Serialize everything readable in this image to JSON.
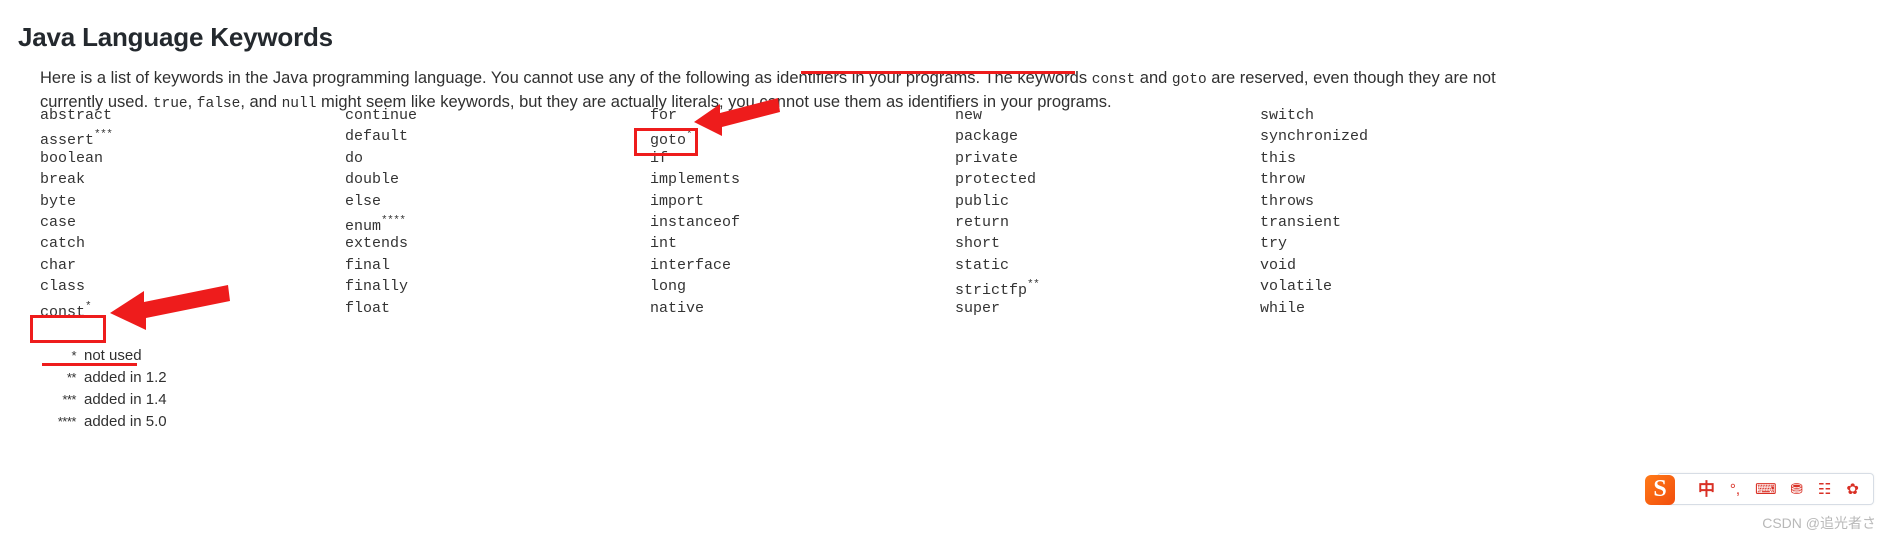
{
  "page": {
    "title": "Java Language Keywords",
    "intro": {
      "part1": "Here is a list of keywords in the Java programming language. You cannot use any of the following as identifiers in your programs. The keywords ",
      "code1": "const",
      "part2": " and ",
      "code2": "goto",
      "part3": " are reserved, even though they are not currently used. ",
      "code3": "true",
      "part4": ", ",
      "code4": "false",
      "part5": ", and ",
      "code5": "null",
      "part6": " might seem like keywords, but they are actually literals; you cannot use them as identifiers in your programs."
    }
  },
  "keywords": {
    "columns": [
      [
        {
          "word": "abstract",
          "mark": ""
        },
        {
          "word": "assert",
          "mark": "***"
        },
        {
          "word": "boolean",
          "mark": ""
        },
        {
          "word": "break",
          "mark": ""
        },
        {
          "word": "byte",
          "mark": ""
        },
        {
          "word": "case",
          "mark": ""
        },
        {
          "word": "catch",
          "mark": ""
        },
        {
          "word": "char",
          "mark": ""
        },
        {
          "word": "class",
          "mark": ""
        },
        {
          "word": "const",
          "mark": "*"
        }
      ],
      [
        {
          "word": "continue",
          "mark": ""
        },
        {
          "word": "default",
          "mark": ""
        },
        {
          "word": "do",
          "mark": ""
        },
        {
          "word": "double",
          "mark": ""
        },
        {
          "word": "else",
          "mark": ""
        },
        {
          "word": "enum",
          "mark": "****"
        },
        {
          "word": "extends",
          "mark": ""
        },
        {
          "word": "final",
          "mark": ""
        },
        {
          "word": "finally",
          "mark": ""
        },
        {
          "word": "float",
          "mark": ""
        }
      ],
      [
        {
          "word": "for",
          "mark": ""
        },
        {
          "word": "goto",
          "mark": "*"
        },
        {
          "word": "if",
          "mark": ""
        },
        {
          "word": "implements",
          "mark": ""
        },
        {
          "word": "import",
          "mark": ""
        },
        {
          "word": "instanceof",
          "mark": ""
        },
        {
          "word": "int",
          "mark": ""
        },
        {
          "word": "interface",
          "mark": ""
        },
        {
          "word": "long",
          "mark": ""
        },
        {
          "word": "native",
          "mark": ""
        }
      ],
      [
        {
          "word": "new",
          "mark": ""
        },
        {
          "word": "package",
          "mark": ""
        },
        {
          "word": "private",
          "mark": ""
        },
        {
          "word": "protected",
          "mark": ""
        },
        {
          "word": "public",
          "mark": ""
        },
        {
          "word": "return",
          "mark": ""
        },
        {
          "word": "short",
          "mark": ""
        },
        {
          "word": "static",
          "mark": ""
        },
        {
          "word": "strictfp",
          "mark": "**"
        },
        {
          "word": "super",
          "mark": ""
        }
      ],
      [
        {
          "word": "switch",
          "mark": ""
        },
        {
          "word": "synchronized",
          "mark": ""
        },
        {
          "word": "this",
          "mark": ""
        },
        {
          "word": "throw",
          "mark": ""
        },
        {
          "word": "throws",
          "mark": ""
        },
        {
          "word": "transient",
          "mark": ""
        },
        {
          "word": "try",
          "mark": ""
        },
        {
          "word": "void",
          "mark": ""
        },
        {
          "word": "volatile",
          "mark": ""
        },
        {
          "word": "while",
          "mark": ""
        }
      ]
    ]
  },
  "footnotes": [
    {
      "mark": "*",
      "text": "not used"
    },
    {
      "mark": "**",
      "text": "added in 1.2"
    },
    {
      "mark": "***",
      "text": "added in 1.4"
    },
    {
      "mark": "****",
      "text": "added in 5.0"
    }
  ],
  "annotations": {
    "highlight_color": "#ee1c1c",
    "boxed_keywords": [
      "const",
      "goto"
    ],
    "underlined_phrase": "The keywords const and goto are reserved,",
    "underlined_footnote": "* not used"
  },
  "ime_toolbar": {
    "logo": "S",
    "items": [
      {
        "name": "input-mode-chinese",
        "glyph": "中"
      },
      {
        "name": "punctuation-mode",
        "glyph": "°,"
      },
      {
        "name": "soft-keyboard",
        "glyph": "⌨"
      },
      {
        "name": "user-account",
        "glyph": "⛃"
      },
      {
        "name": "toolbox-grid",
        "glyph": "☷"
      },
      {
        "name": "skin-settings",
        "glyph": "✿"
      }
    ]
  },
  "watermark": {
    "text": "CSDN @追光者さ"
  }
}
